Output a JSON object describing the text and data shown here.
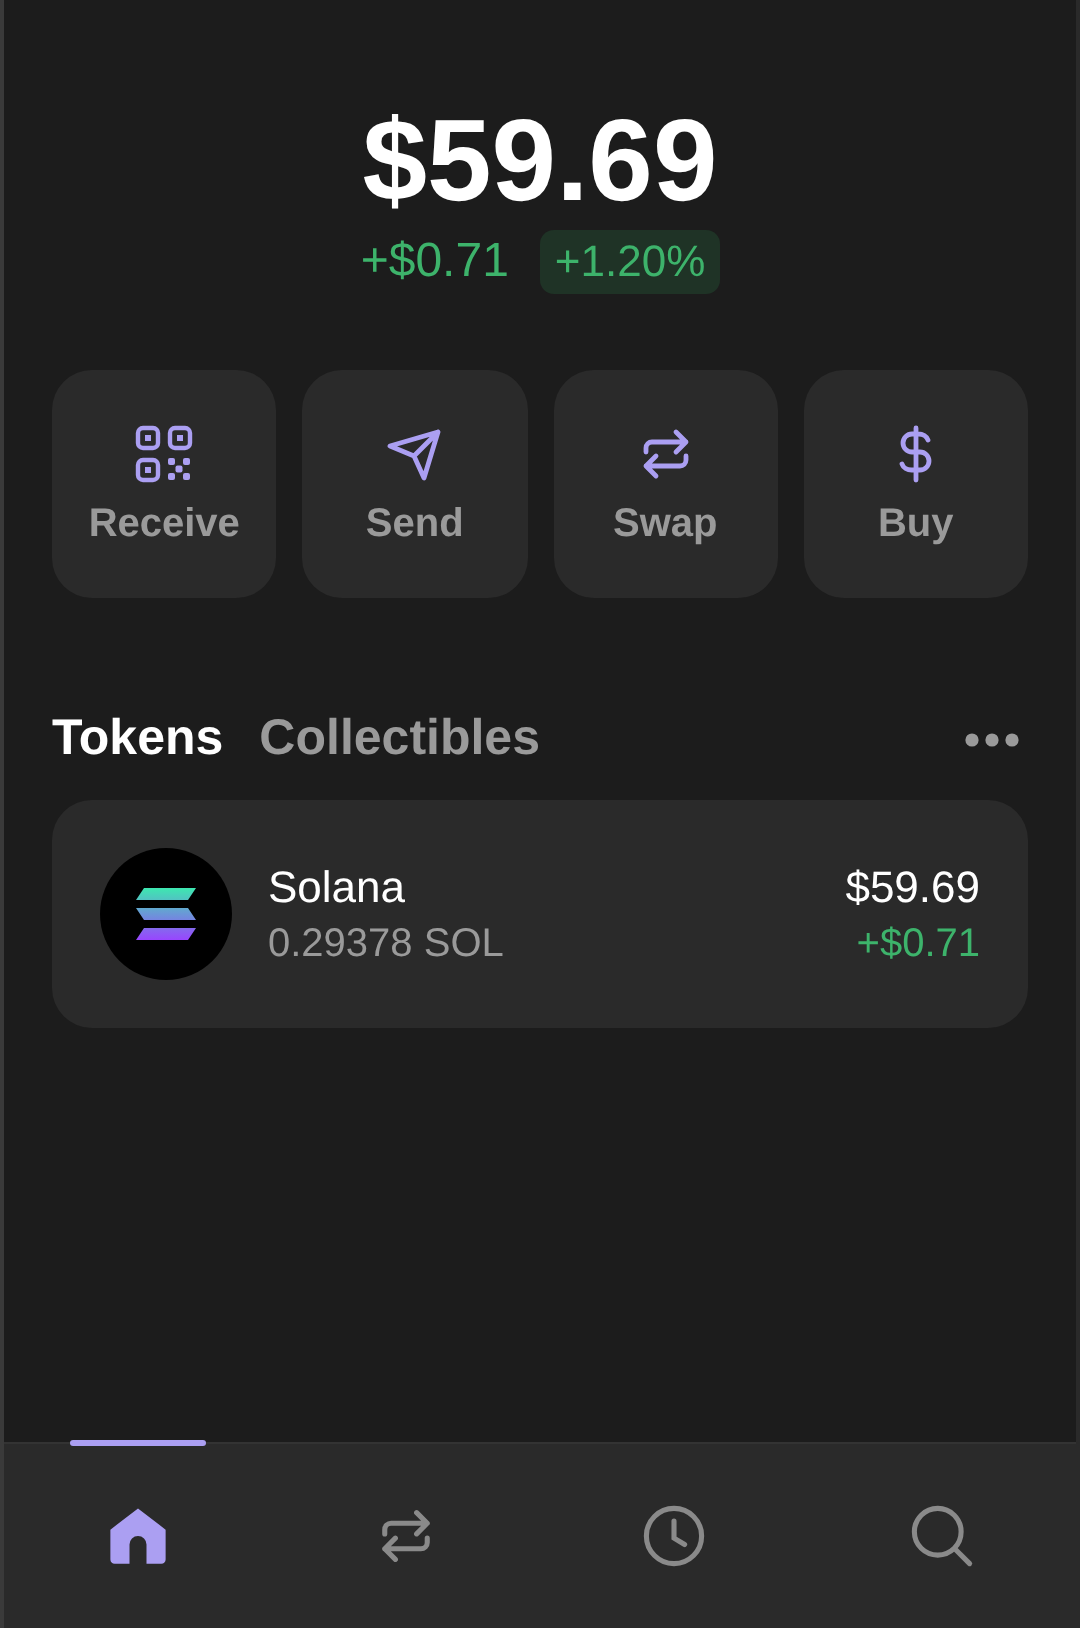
{
  "balance": {
    "total": "$59.69",
    "change": "+$0.71",
    "percent": "+1.20%"
  },
  "actions": [
    {
      "kind": "receive",
      "label": "Receive"
    },
    {
      "kind": "send",
      "label": "Send"
    },
    {
      "kind": "swap",
      "label": "Swap"
    },
    {
      "kind": "buy",
      "label": "Buy"
    }
  ],
  "tabs": [
    {
      "label": "Tokens",
      "selected": true
    },
    {
      "label": "Collectibles",
      "selected": false
    }
  ],
  "tokens": [
    {
      "name": "Solana",
      "amount": "0.29378 SOL",
      "value": "$59.69",
      "change": "+$0.71"
    }
  ],
  "nav": [
    {
      "kind": "home",
      "selected": true
    },
    {
      "kind": "swap",
      "selected": false
    },
    {
      "kind": "history",
      "selected": false
    },
    {
      "kind": "search",
      "selected": false
    }
  ]
}
